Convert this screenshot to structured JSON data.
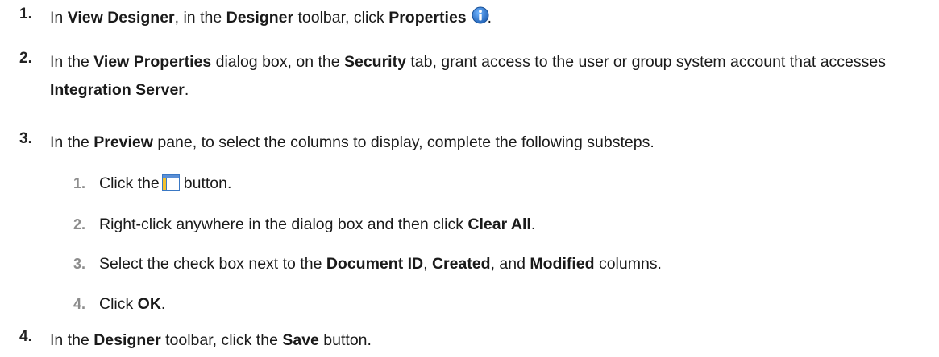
{
  "steps": [
    {
      "num": "1.",
      "p1": "In ",
      "b1": "View Designer",
      "p2": ", in the ",
      "b2": "Designer",
      "p3": " toolbar, click ",
      "b3": "Properties",
      "icon": "info-icon",
      "p4": "."
    },
    {
      "num": "2.",
      "p1": "In the ",
      "b1": "View Properties",
      "p2": " dialog box, on the ",
      "b2": "Security",
      "p3": " tab, grant access to the user or group system account that accesses ",
      "b3": "Integration Server",
      "p4": "."
    },
    {
      "num": "3.",
      "p1": "In the ",
      "b1": "Preview",
      "p2": " pane, to select the columns to display, complete the following substeps.",
      "substeps": [
        {
          "num": "1.",
          "p1": "Click the",
          "icon": "columns-icon",
          "p2": "button."
        },
        {
          "num": "2.",
          "p1": "Right-click anywhere in the dialog box and then click ",
          "b1": "Clear All",
          "p2": "."
        },
        {
          "num": "3.",
          "p1": "Select the check box next to the ",
          "b1": "Document ID",
          "p2": ", ",
          "b2": "Created",
          "p3": ", and ",
          "b3": "Modified",
          "p4": " columns."
        },
        {
          "num": "4.",
          "p1": "Click ",
          "b1": "OK",
          "p2": "."
        }
      ]
    },
    {
      "num": "4.",
      "p1": "In the ",
      "b1": "Designer",
      "p2": " toolbar, click the ",
      "b2": "Save",
      "p3": " button."
    }
  ],
  "colors": {
    "info_icon": "#1e73c8",
    "columns_icon_frame": "#3a78c4",
    "columns_icon_fill": "#f2c230"
  }
}
